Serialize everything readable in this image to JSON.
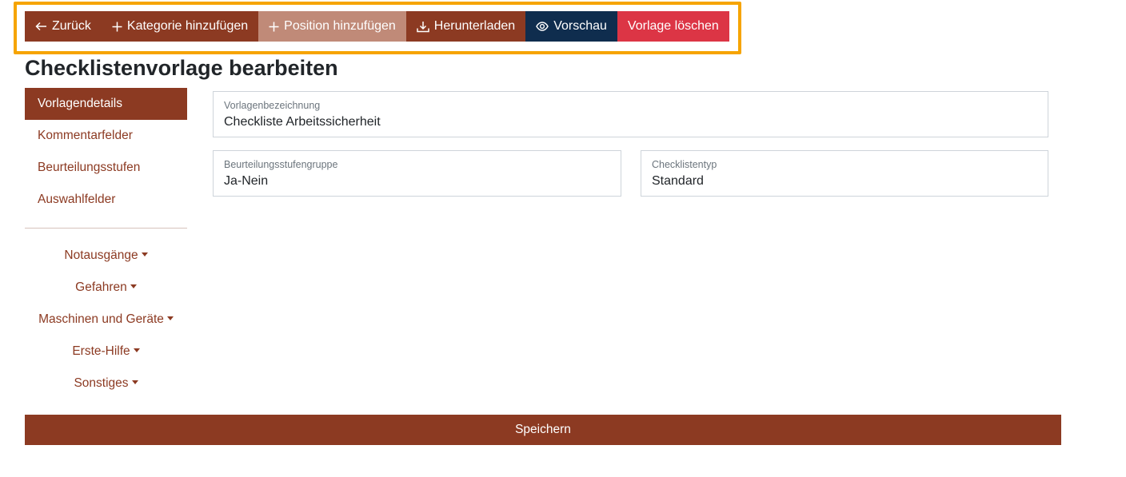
{
  "toolbar": {
    "back_label": "Zurück",
    "add_category_label": "Kategorie hinzufügen",
    "add_position_label": "Position hinzufügen",
    "download_label": "Herunterladen",
    "preview_label": "Vorschau",
    "delete_label": "Vorlage löschen"
  },
  "page": {
    "title": "Checklistenvorlage bearbeiten"
  },
  "sidebar": {
    "items": [
      {
        "label": "Vorlagendetails",
        "active": true
      },
      {
        "label": "Kommentarfelder",
        "active": false
      },
      {
        "label": "Beurteilungsstufen",
        "active": false
      },
      {
        "label": "Auswahlfelder",
        "active": false
      }
    ],
    "categories": [
      {
        "label": "Notausgänge"
      },
      {
        "label": "Gefahren"
      },
      {
        "label": "Maschinen und Geräte"
      },
      {
        "label": "Erste-Hilfe"
      },
      {
        "label": "Sonstiges"
      }
    ]
  },
  "form": {
    "template_name": {
      "label": "Vorlagenbezeichnung",
      "value": "Checkliste Arbeitssicherheit"
    },
    "rating_group": {
      "label": "Beurteilungsstufengruppe",
      "value": "Ja-Nein"
    },
    "checklist_type": {
      "label": "Checklistentyp",
      "value": "Standard"
    },
    "save_label": "Speichern"
  },
  "colors": {
    "primary": "#8c3a22",
    "primary_disabled": "#c08a78",
    "dark": "#0f2d4e",
    "danger": "#dc3545",
    "highlight": "#f6a400"
  }
}
